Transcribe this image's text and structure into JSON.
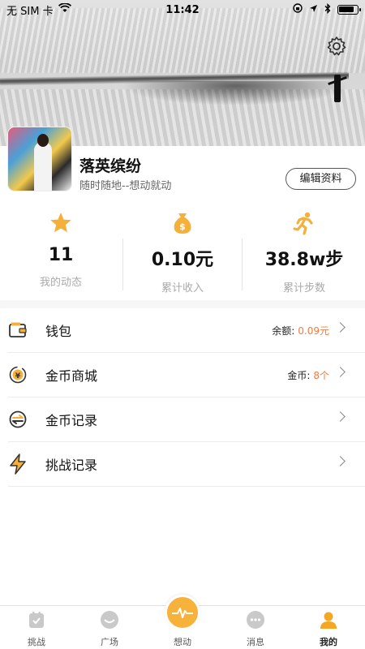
{
  "status_bar": {
    "carrier": "无 SIM 卡",
    "time": "11:42",
    "battery_level": 0.85
  },
  "profile": {
    "name": "落英缤纷",
    "subtitle": "随时随地--想动就动",
    "edit_label": "编辑资料"
  },
  "stats": [
    {
      "icon": "star-icon",
      "value": "11",
      "label": "我的动态"
    },
    {
      "icon": "money-bag-icon",
      "value": "0.10元",
      "label": "累计收入"
    },
    {
      "icon": "runner-icon",
      "value": "38.8w步",
      "label": "累计步数"
    }
  ],
  "menu": [
    {
      "icon": "wallet-icon",
      "label": "钱包",
      "meta_label": "余额:",
      "meta_value": "0.09元"
    },
    {
      "icon": "coin-yen-icon",
      "label": "金币商城",
      "meta_label": "金币:",
      "meta_value": "8个"
    },
    {
      "icon": "coin-exchange-icon",
      "label": "金币记录",
      "meta_label": "",
      "meta_value": ""
    },
    {
      "icon": "lightning-icon",
      "label": "挑战记录",
      "meta_label": "",
      "meta_value": ""
    }
  ],
  "tabs": [
    {
      "icon": "challenge-icon",
      "label": "挑战"
    },
    {
      "icon": "plaza-icon",
      "label": "广场"
    },
    {
      "icon": "pulse-icon",
      "label": "想动"
    },
    {
      "icon": "message-icon",
      "label": "消息"
    },
    {
      "icon": "profile-icon",
      "label": "我的"
    }
  ],
  "colors": {
    "accent": "#f7b23b",
    "highlight_value": "#f07b3f"
  }
}
